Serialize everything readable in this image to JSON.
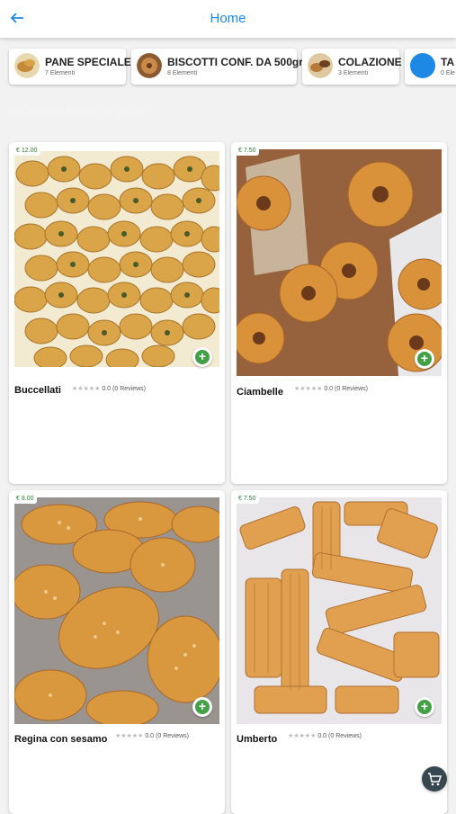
{
  "appbar": {
    "title": "Home",
    "back_icon": "arrow-left-icon"
  },
  "categories": [
    {
      "name": "PANE SPECIALE",
      "count": "7 Elementi"
    },
    {
      "name": "BISCOTTI CONF. DA 500gr",
      "count": "8 Elementi"
    },
    {
      "name": "COLAZIONE",
      "count": "3 Elementi"
    },
    {
      "name": "TA",
      "count": "0 Ele"
    }
  ],
  "section_title": "Biscotti e dolci di pasta",
  "products": [
    {
      "name": "Buccellati",
      "price": "€ 12.00",
      "rating": "0.0 (0 Reviews)"
    },
    {
      "name": "Ciambelle",
      "price": "€ 7.50",
      "rating": "0.0 (0 Reviews)"
    },
    {
      "name": "Regina con sesamo",
      "price": "€ 8.00",
      "rating": "0.0 (0 Reviews)"
    },
    {
      "name": "Umberto",
      "price": "€ 7.50",
      "rating": "0.0 (0 Reviews)"
    }
  ],
  "stars": "★★★★★",
  "add_symbol": "+",
  "cart_icon": "cart-icon",
  "colors": {
    "accent": "#1e88e5",
    "add": "#43a047",
    "price": "#2e7d32",
    "cart": "#37474f"
  }
}
